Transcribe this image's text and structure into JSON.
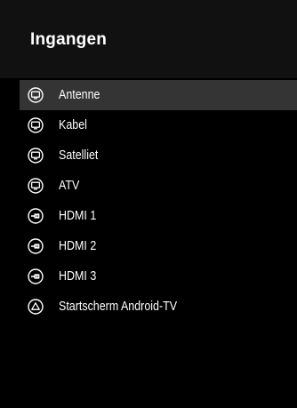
{
  "panel": {
    "title": "Ingangen"
  },
  "inputs": [
    {
      "label": "Antenne",
      "icon": "tv-icon",
      "selected": true
    },
    {
      "label": "Kabel",
      "icon": "tv-icon",
      "selected": false
    },
    {
      "label": "Satelliet",
      "icon": "tv-icon",
      "selected": false
    },
    {
      "label": "ATV",
      "icon": "tv-icon",
      "selected": false
    },
    {
      "label": "HDMI 1",
      "icon": "hdmi-icon",
      "selected": false
    },
    {
      "label": "HDMI 2",
      "icon": "hdmi-icon",
      "selected": false
    },
    {
      "label": "HDMI 3",
      "icon": "hdmi-icon",
      "selected": false
    },
    {
      "label": "Startscherm Android-TV",
      "icon": "home-triangle-icon",
      "selected": false
    }
  ],
  "colors": {
    "background": "#000000",
    "header_background": "#111111",
    "selected_row": "#343434",
    "text": "#ffffff"
  }
}
